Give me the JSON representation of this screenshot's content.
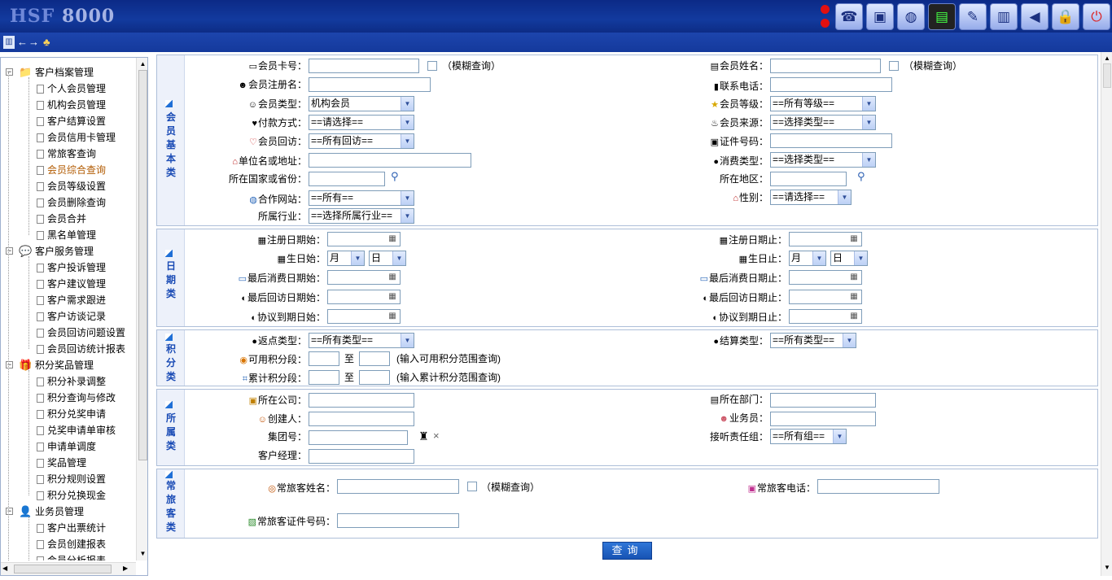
{
  "app": {
    "logo_prefix": "HSF",
    "logo_num": "8000"
  },
  "toolbar": {
    "icons": [
      "phone-icon",
      "monitor-icon",
      "globe-icon",
      "terminal-icon",
      "notepad-icon",
      "books-icon",
      "megaphone-icon",
      "lock-icon",
      "power-icon"
    ]
  },
  "nav": {
    "back": "←",
    "forward": "→"
  },
  "tree": [
    {
      "label": "客户档案管理",
      "children": [
        "个人会员管理",
        "机构会员管理",
        "客户结算设置",
        "会员信用卡管理",
        "常旅客查询",
        "会员综合查询",
        "会员等级设置",
        "会员删除查询",
        "会员合并",
        "黑名单管理"
      ]
    },
    {
      "label": "客户服务管理",
      "children": [
        "客户投诉管理",
        "客户建议管理",
        "客户需求跟进",
        "客户访谈记录",
        "会员回访问题设置",
        "会员回访统计报表"
      ]
    },
    {
      "label": "积分奖品管理",
      "children": [
        "积分补录调整",
        "积分查询与修改",
        "积分兑奖申请",
        "兑奖申请单审核",
        "申请单调度",
        "奖品管理",
        "积分规则设置",
        "积分兑换现金"
      ]
    },
    {
      "label": "业务员管理",
      "children": [
        "客户出票统计",
        "会员创建报表",
        "会员分析报表"
      ]
    }
  ],
  "current_item": "会员综合查询",
  "sections": {
    "basic": "会员基本类",
    "date": "日期类",
    "points": "积分类",
    "belong": "所属类",
    "traveler": "常旅客类"
  },
  "basic": {
    "card_no": "会员卡号：",
    "fuzzy": "（模糊查询）",
    "member_name": "会员姓名：",
    "reg_name": "会员注册名：",
    "phone": "联系电话：",
    "member_type": "会员类型：",
    "member_type_val": "机构会员",
    "member_level": "会员等级：",
    "member_level_val": "==所有等级==",
    "pay": "付款方式：",
    "pay_val": "==请选择==",
    "source": "会员来源：",
    "source_val": "==选择类型==",
    "visit": "会员回访：",
    "visit_val": "==所有回访==",
    "cert": "证件号码：",
    "unit": "单位名或地址：",
    "consume": "消费类型：",
    "consume_val": "==选择类型==",
    "country": "所在国家或省份：",
    "region": "所在地区：",
    "site": "合作网站：",
    "site_val": "==所有==",
    "gender": "性别：",
    "gender_val": "==请选择==",
    "industry": "所属行业：",
    "industry_val": "==选择所属行业=="
  },
  "date": {
    "reg_start": "注册日期始：",
    "reg_end": "注册日期止：",
    "bday_start": "生日始：",
    "bday_end": "生日止：",
    "month": "月",
    "day": "日",
    "last_consume_start": "最后消费日期始：",
    "last_consume_end": "最后消费日期止：",
    "last_visit_start": "最后回访日期始：",
    "last_visit_end": "最后回访日期止：",
    "agree_start": "协议到期日始：",
    "agree_end": "协议到期日止："
  },
  "points": {
    "rebate": "返点类型：",
    "rebate_val": "==所有类型==",
    "settle": "结算类型：",
    "settle_val": "==所有类型==",
    "avail": "可用积分段：",
    "to": "至",
    "avail_hint": "(输入可用积分范围查询)",
    "accum": "累计积分段：",
    "accum_hint": "(输入累计积分范围查询)"
  },
  "belong": {
    "company": "所在公司：",
    "dept": "所在部门：",
    "creator": "创建人：",
    "salesman": "业务员：",
    "group": "集团号：",
    "group_clear": "×",
    "listen": "接听责任组：",
    "listen_val": "==所有组==",
    "manager": "客户经理："
  },
  "traveler": {
    "name": "常旅客姓名：",
    "fuzzy": "（模糊查询）",
    "phone": "常旅客电话：",
    "cert": "常旅客证件号码："
  },
  "query_button": "查询"
}
